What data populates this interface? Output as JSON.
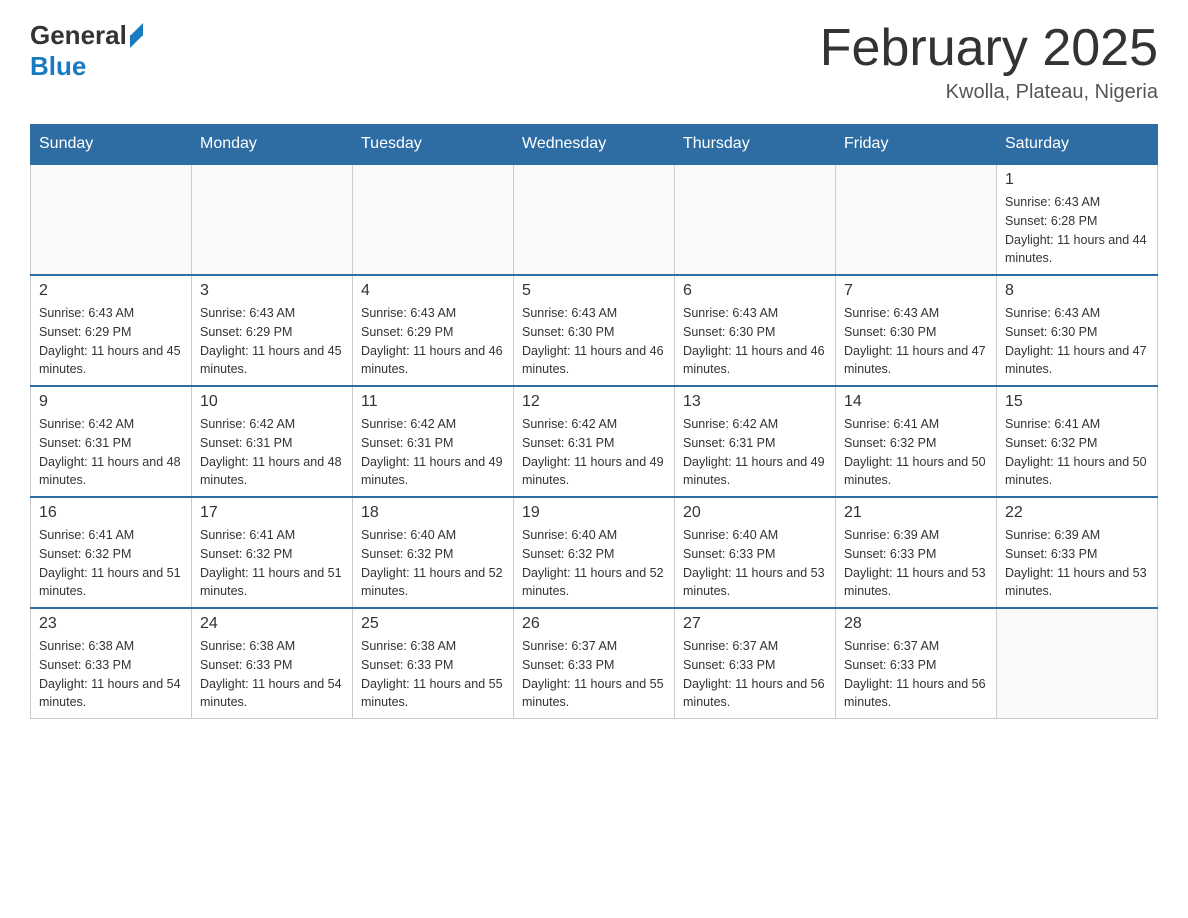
{
  "header": {
    "logo_general": "General",
    "logo_blue": "Blue",
    "month_title": "February 2025",
    "location": "Kwolla, Plateau, Nigeria"
  },
  "days_of_week": [
    "Sunday",
    "Monday",
    "Tuesday",
    "Wednesday",
    "Thursday",
    "Friday",
    "Saturday"
  ],
  "weeks": [
    [
      {
        "day": "",
        "info": ""
      },
      {
        "day": "",
        "info": ""
      },
      {
        "day": "",
        "info": ""
      },
      {
        "day": "",
        "info": ""
      },
      {
        "day": "",
        "info": ""
      },
      {
        "day": "",
        "info": ""
      },
      {
        "day": "1",
        "info": "Sunrise: 6:43 AM\nSunset: 6:28 PM\nDaylight: 11 hours and 44 minutes."
      }
    ],
    [
      {
        "day": "2",
        "info": "Sunrise: 6:43 AM\nSunset: 6:29 PM\nDaylight: 11 hours and 45 minutes."
      },
      {
        "day": "3",
        "info": "Sunrise: 6:43 AM\nSunset: 6:29 PM\nDaylight: 11 hours and 45 minutes."
      },
      {
        "day": "4",
        "info": "Sunrise: 6:43 AM\nSunset: 6:29 PM\nDaylight: 11 hours and 46 minutes."
      },
      {
        "day": "5",
        "info": "Sunrise: 6:43 AM\nSunset: 6:30 PM\nDaylight: 11 hours and 46 minutes."
      },
      {
        "day": "6",
        "info": "Sunrise: 6:43 AM\nSunset: 6:30 PM\nDaylight: 11 hours and 46 minutes."
      },
      {
        "day": "7",
        "info": "Sunrise: 6:43 AM\nSunset: 6:30 PM\nDaylight: 11 hours and 47 minutes."
      },
      {
        "day": "8",
        "info": "Sunrise: 6:43 AM\nSunset: 6:30 PM\nDaylight: 11 hours and 47 minutes."
      }
    ],
    [
      {
        "day": "9",
        "info": "Sunrise: 6:42 AM\nSunset: 6:31 PM\nDaylight: 11 hours and 48 minutes."
      },
      {
        "day": "10",
        "info": "Sunrise: 6:42 AM\nSunset: 6:31 PM\nDaylight: 11 hours and 48 minutes."
      },
      {
        "day": "11",
        "info": "Sunrise: 6:42 AM\nSunset: 6:31 PM\nDaylight: 11 hours and 49 minutes."
      },
      {
        "day": "12",
        "info": "Sunrise: 6:42 AM\nSunset: 6:31 PM\nDaylight: 11 hours and 49 minutes."
      },
      {
        "day": "13",
        "info": "Sunrise: 6:42 AM\nSunset: 6:31 PM\nDaylight: 11 hours and 49 minutes."
      },
      {
        "day": "14",
        "info": "Sunrise: 6:41 AM\nSunset: 6:32 PM\nDaylight: 11 hours and 50 minutes."
      },
      {
        "day": "15",
        "info": "Sunrise: 6:41 AM\nSunset: 6:32 PM\nDaylight: 11 hours and 50 minutes."
      }
    ],
    [
      {
        "day": "16",
        "info": "Sunrise: 6:41 AM\nSunset: 6:32 PM\nDaylight: 11 hours and 51 minutes."
      },
      {
        "day": "17",
        "info": "Sunrise: 6:41 AM\nSunset: 6:32 PM\nDaylight: 11 hours and 51 minutes."
      },
      {
        "day": "18",
        "info": "Sunrise: 6:40 AM\nSunset: 6:32 PM\nDaylight: 11 hours and 52 minutes."
      },
      {
        "day": "19",
        "info": "Sunrise: 6:40 AM\nSunset: 6:32 PM\nDaylight: 11 hours and 52 minutes."
      },
      {
        "day": "20",
        "info": "Sunrise: 6:40 AM\nSunset: 6:33 PM\nDaylight: 11 hours and 53 minutes."
      },
      {
        "day": "21",
        "info": "Sunrise: 6:39 AM\nSunset: 6:33 PM\nDaylight: 11 hours and 53 minutes."
      },
      {
        "day": "22",
        "info": "Sunrise: 6:39 AM\nSunset: 6:33 PM\nDaylight: 11 hours and 53 minutes."
      }
    ],
    [
      {
        "day": "23",
        "info": "Sunrise: 6:38 AM\nSunset: 6:33 PM\nDaylight: 11 hours and 54 minutes."
      },
      {
        "day": "24",
        "info": "Sunrise: 6:38 AM\nSunset: 6:33 PM\nDaylight: 11 hours and 54 minutes."
      },
      {
        "day": "25",
        "info": "Sunrise: 6:38 AM\nSunset: 6:33 PM\nDaylight: 11 hours and 55 minutes."
      },
      {
        "day": "26",
        "info": "Sunrise: 6:37 AM\nSunset: 6:33 PM\nDaylight: 11 hours and 55 minutes."
      },
      {
        "day": "27",
        "info": "Sunrise: 6:37 AM\nSunset: 6:33 PM\nDaylight: 11 hours and 56 minutes."
      },
      {
        "day": "28",
        "info": "Sunrise: 6:37 AM\nSunset: 6:33 PM\nDaylight: 11 hours and 56 minutes."
      },
      {
        "day": "",
        "info": ""
      }
    ]
  ]
}
